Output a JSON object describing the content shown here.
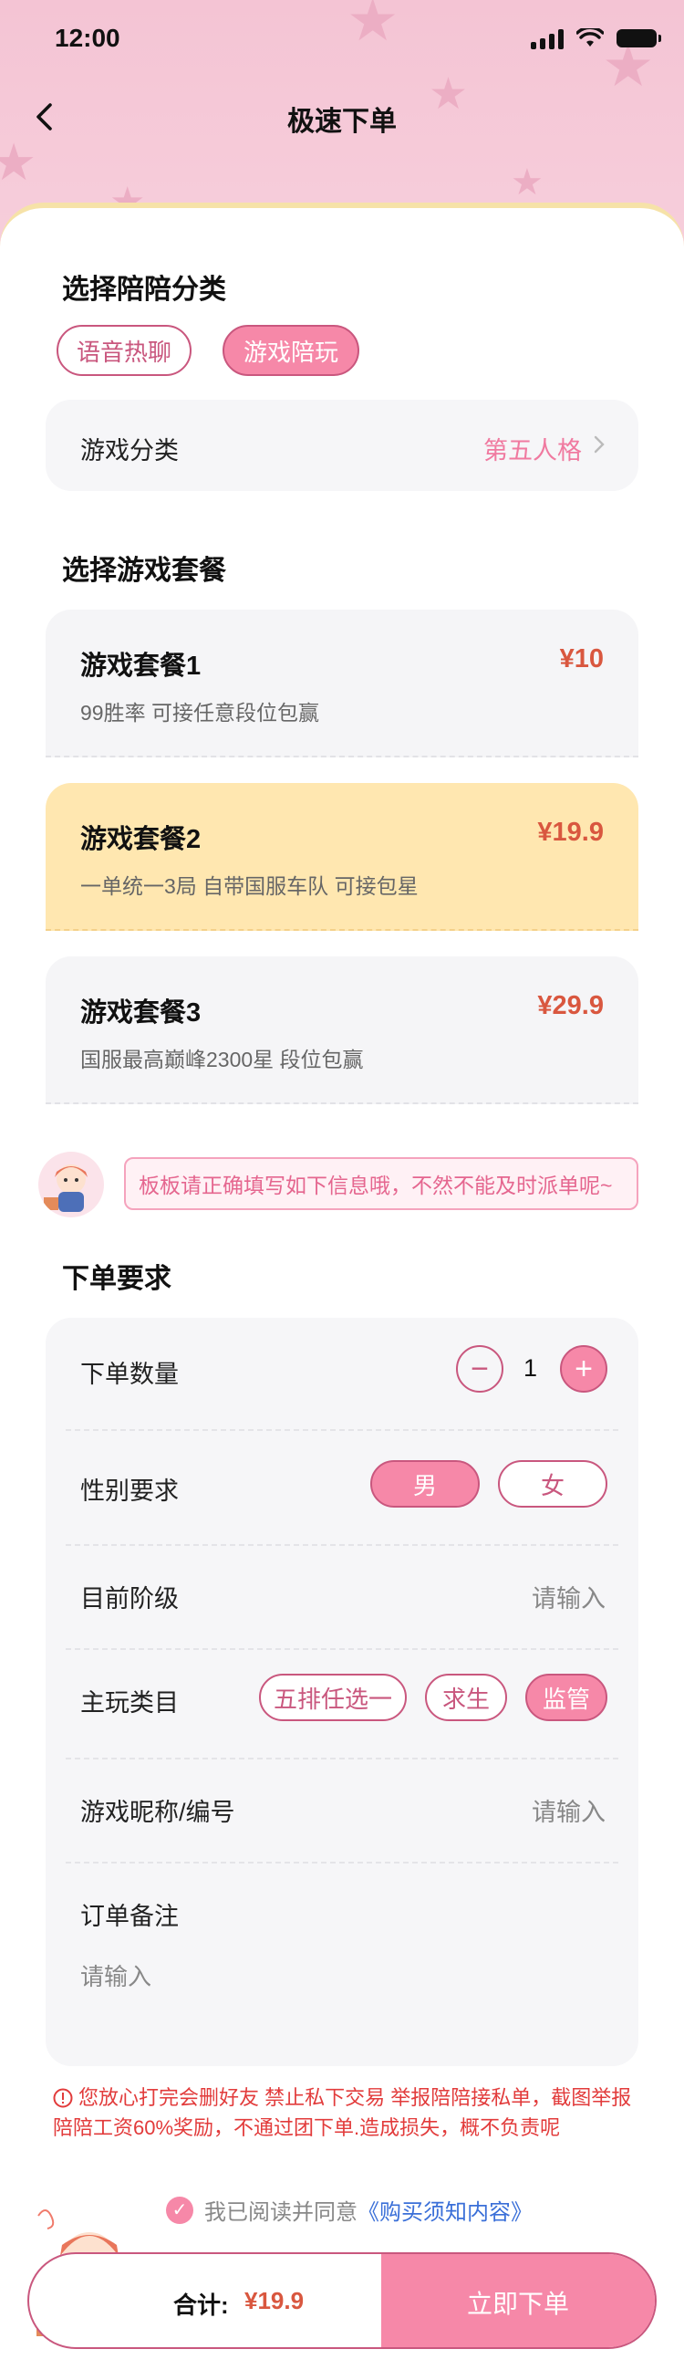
{
  "status_bar": {
    "time": "12:00"
  },
  "nav": {
    "title": "极速下单"
  },
  "category": {
    "title": "选择陪陪分类",
    "chips": [
      "语音热聊",
      "游戏陪玩"
    ],
    "active_chip": "游戏陪玩",
    "game_row": {
      "label": "游戏分类",
      "value": "第五人格"
    }
  },
  "packages": {
    "title": "选择游戏套餐",
    "items": [
      {
        "name": "游戏套餐1",
        "price": "¥10",
        "desc": "99胜率 可接任意段位包赢"
      },
      {
        "name": "游戏套餐2",
        "price": "¥19.9",
        "desc": "一单统一3局 自带国服车队 可接包星",
        "selected": true
      },
      {
        "name": "游戏套餐3",
        "price": "¥29.9",
        "desc": "国服最高巅峰2300星 段位包赢"
      }
    ]
  },
  "notice": {
    "text": "板板请正确填写如下信息哦，不然不能及时派单呢~"
  },
  "requirements": {
    "title": "下单要求",
    "quantity": {
      "label": "下单数量",
      "value": "1",
      "minus": "−",
      "plus": "+"
    },
    "gender": {
      "label": "性别要求",
      "options": [
        "男",
        "女"
      ],
      "selected": "男"
    },
    "rank": {
      "label": "目前阶级",
      "placeholder": "请输入"
    },
    "main_type": {
      "label": "主玩类目",
      "options": [
        "五排任选一",
        "求生",
        "监管"
      ],
      "selected": "监管"
    },
    "nickname": {
      "label": "游戏昵称/编号",
      "placeholder": "请输入"
    },
    "remark": {
      "label": "订单备注",
      "placeholder": "请输入"
    }
  },
  "warning": {
    "text": "您放心打完会删好友 禁止私下交易 举报陪陪接私单，截图举报陪陪工资60%奖励，不通过团下单.造成损失，概不负责呢"
  },
  "agreement": {
    "prefix": "我已阅读并同意",
    "link": "《购买须知内容》",
    "checked": true
  },
  "footer": {
    "total_label": "合计:",
    "total_value": "¥19.9",
    "submit": "立即下单"
  },
  "colors": {
    "accent": "#f688a8",
    "accent_border": "#c9577e",
    "price": "#d9573f",
    "selected_card": "#ffe7b0",
    "warning": "#e23b3b",
    "link": "#3a6fd8"
  }
}
